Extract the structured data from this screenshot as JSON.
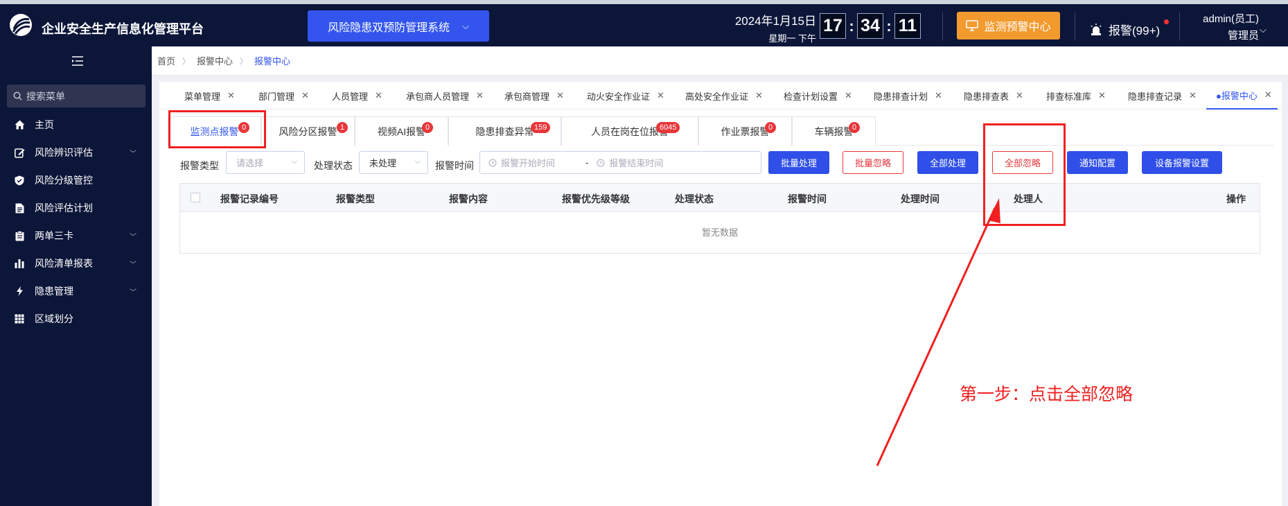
{
  "header": {
    "app_title": "企业安全生产信息化管理平台",
    "system_select": "风险隐患双预防管理系统",
    "date": "2024年1月15日",
    "weekday": "星期一  下午",
    "clock": {
      "h": "17",
      "m": "34",
      "s": "11"
    },
    "monitor_button": "监测预警中心",
    "alarm": "报警(99+)",
    "user_name": "admin(员工)",
    "user_role": "管理员",
    "accent": "#3355ee",
    "monitor_color": "#f39a2f"
  },
  "sidebar": {
    "search_placeholder": "搜索菜单",
    "items": [
      {
        "label": "主页",
        "icon": "home-icon",
        "expandable": false
      },
      {
        "label": "风险辨识评估",
        "icon": "edit-icon",
        "expandable": true
      },
      {
        "label": "风险分级管控",
        "icon": "shield-icon",
        "expandable": false
      },
      {
        "label": "风险评估计划",
        "icon": "document-icon",
        "expandable": false
      },
      {
        "label": "两单三卡",
        "icon": "clipboard-icon",
        "expandable": true
      },
      {
        "label": "风险清单报表",
        "icon": "bar-chart-icon",
        "expandable": true
      },
      {
        "label": "隐患管理",
        "icon": "lightning-icon",
        "expandable": true
      },
      {
        "label": "区域划分",
        "icon": "grid-icon",
        "expandable": false
      }
    ]
  },
  "breadcrumb": [
    "首页",
    "报警中心",
    "报警中心"
  ],
  "tabs": [
    {
      "label": "菜单管理",
      "active": false
    },
    {
      "label": "部门管理",
      "active": false
    },
    {
      "label": "人员管理",
      "active": false
    },
    {
      "label": "承包商人员管理",
      "active": false
    },
    {
      "label": "承包商管理",
      "active": false
    },
    {
      "label": "动火安全作业证",
      "active": false
    },
    {
      "label": "高处安全作业证",
      "active": false
    },
    {
      "label": "检查计划设置",
      "active": false
    },
    {
      "label": "隐患排查计划",
      "active": false
    },
    {
      "label": "隐患排查表",
      "active": false
    },
    {
      "label": "排查标准库",
      "active": false
    },
    {
      "label": "隐患排查记录",
      "active": false
    },
    {
      "label": "●报警中心",
      "active": true
    }
  ],
  "subtabs": [
    {
      "label": "监测点报警",
      "badge": "0",
      "active": true
    },
    {
      "label": "风险分区报警",
      "badge": "1",
      "active": false
    },
    {
      "label": "视频AI报警",
      "badge": "0",
      "active": false
    },
    {
      "label": "隐患排查异常",
      "badge": "159",
      "active": false
    },
    {
      "label": "人员在岗在位报警",
      "badge": "6045",
      "active": false
    },
    {
      "label": "作业票报警",
      "badge": "0",
      "active": false
    },
    {
      "label": "车辆报警",
      "badge": "0",
      "active": false
    }
  ],
  "filters": {
    "alarm_type_label": "报警类型",
    "alarm_type_placeholder": "请选择",
    "status_label": "处理状态",
    "status_value": "未处理",
    "time_label": "报警时间",
    "start_placeholder": "报警开始时间",
    "range_sep": "-",
    "end_placeholder": "报警结束时间"
  },
  "buttons": {
    "batch_process": "批量处理",
    "batch_ignore": "批量忽略",
    "process_all": "全部处理",
    "ignore_all": "全部忽略",
    "notify_config": "通知配置",
    "device_alarm_settings": "设备报警设置"
  },
  "table": {
    "columns": [
      "报警记录编号",
      "报警类型",
      "报警内容",
      "报警优先级等级",
      "处理状态",
      "报警时间",
      "处理时间",
      "处理人",
      "操作"
    ],
    "empty_text": "暂无数据"
  },
  "annotation": {
    "text": "第一步：点击全部忽略",
    "color": "#f02020"
  }
}
